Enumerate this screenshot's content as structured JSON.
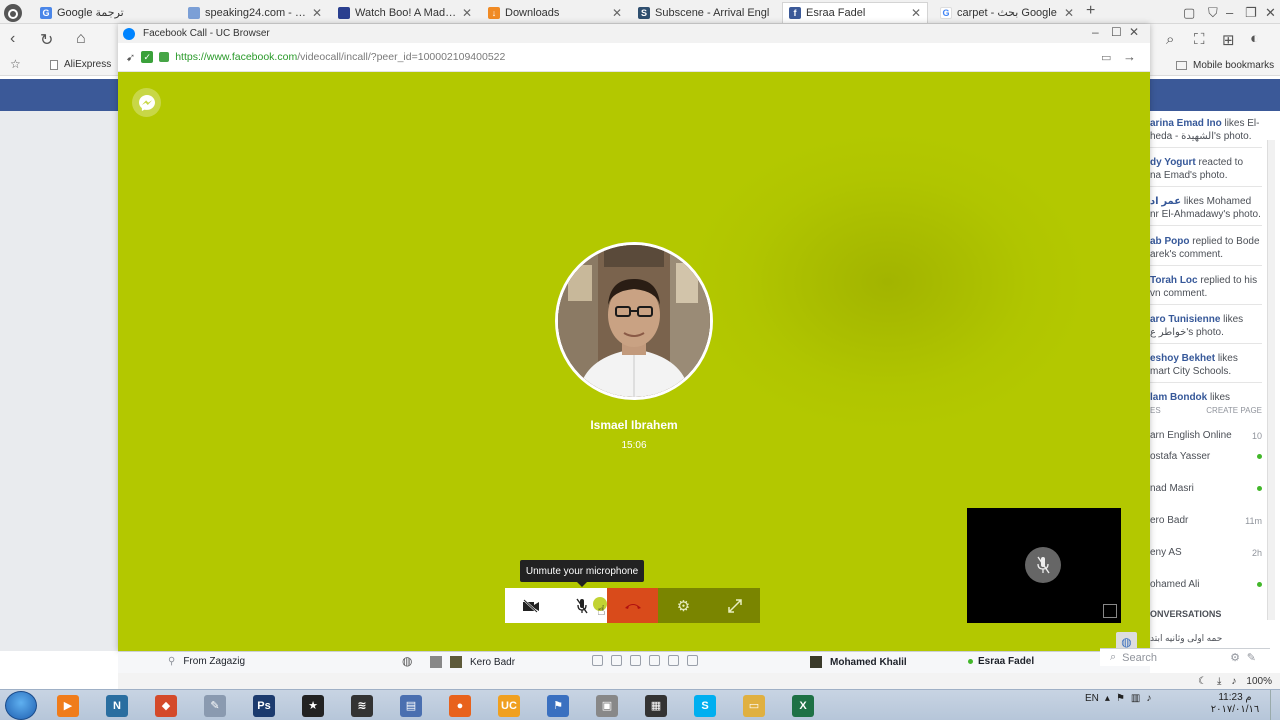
{
  "browser": {
    "tabs": [
      {
        "title": "Google ترجمة",
        "icon": "google-translate-icon",
        "color": "#4a86e8"
      },
      {
        "title": "speaking24.com - find a",
        "icon": "people-icon",
        "color": "#7b9fd6"
      },
      {
        "title": "Watch Boo! A Madea H",
        "icon": "film-icon",
        "color": "#2a3f8f"
      },
      {
        "title": "Downloads",
        "icon": "download-icon",
        "color": "#f08a24"
      },
      {
        "title": "Subscene - Arrival Engl",
        "icon": "subscene-icon",
        "color": "#2f4f6f"
      },
      {
        "title": "Esraa Fadel",
        "icon": "facebook-icon",
        "color": "#3b5998"
      },
      {
        "title": "carpet - بحث Google",
        "icon": "google-icon",
        "color": "#ffffff"
      }
    ],
    "bookmark_aliexpress": "AliExpress",
    "mobile_bookmarks": "Mobile bookmarks"
  },
  "popup": {
    "title": "Facebook Call - UC Browser",
    "url_host": "https://www.facebook.com",
    "url_path": "/videocall/incall/?peer_id=100002109400522"
  },
  "call": {
    "caller_name": "Ismael Ibrahem",
    "duration": "15:06",
    "tooltip": "Unmute your microphone",
    "bg_color": "#b3c800",
    "end_color": "#d94b1b"
  },
  "ticker": [
    {
      "name": "arina Emad Ino",
      "text": "likes El-",
      "line2": "heda - الشهيدة's photo."
    },
    {
      "name": "dy Yogurt",
      "text": "reacted to",
      "line2": "na Emad's photo."
    },
    {
      "name": "عمر اد",
      "text": "likes Mohamed",
      "line2": "nr El-Ahmadawy's photo."
    },
    {
      "name": "ab Popo",
      "text": "replied to Bode",
      "line2": "arek's comment."
    },
    {
      "name": "Torah Loc",
      "text": "replied to his",
      "line2": "vn comment."
    },
    {
      "name": "aro Tunisienne",
      "text": "likes",
      "line2": "خواطر ع's photo."
    },
    {
      "name": "eshoy Bekhet",
      "text": "likes",
      "line2": "mart City Schools."
    },
    {
      "name": "lam Bondok",
      "text": "likes",
      "line2": ""
    }
  ],
  "sidebar": {
    "pages_label": "ES",
    "create_page": "CREATE PAGE",
    "first_contact": "arn English Online",
    "first_count": "10",
    "contacts": [
      {
        "name": "ostafa Yasser",
        "status": "online"
      },
      {
        "name": "nad Masri",
        "status": "online"
      },
      {
        "name": "ero Badr",
        "time": "11m"
      },
      {
        "name": "eny AS",
        "time": "2h"
      },
      {
        "name": "ohamed Ali",
        "status": "online"
      }
    ],
    "conversations_label": "ONVERSATIONS",
    "conversation_item": "حمه اولى وثانيه ابتد",
    "search_placeholder": "Search"
  },
  "chat_tabs": {
    "from": "From Zagazig",
    "tab1": "Kero Badr",
    "tab2": "Mohamed Khalil",
    "tab3": "Esraa Fadel"
  },
  "status_zoom": "100%",
  "taskbar": {
    "apps": [
      {
        "name": "media-player-icon",
        "label": "▶",
        "color": "#f07c1a"
      },
      {
        "name": "n-app-icon",
        "label": "N",
        "color": "#2a6ea0"
      },
      {
        "name": "game-icon",
        "label": "◆",
        "color": "#d44a2a"
      },
      {
        "name": "paint-icon",
        "label": "✎",
        "color": "#8a9ab0"
      },
      {
        "name": "photoshop-icon",
        "label": "Ps",
        "color": "#1c3b6e"
      },
      {
        "name": "movie-maker-icon",
        "label": "★",
        "color": "#222222"
      },
      {
        "name": "audio-editor-icon",
        "label": "≋",
        "color": "#333333"
      },
      {
        "name": "save-app-icon",
        "label": "▤",
        "color": "#4a6fb0"
      },
      {
        "name": "firefox-icon",
        "label": "●",
        "color": "#e8621c"
      },
      {
        "name": "uc-browser-icon",
        "label": "UC",
        "color": "#f0a020"
      },
      {
        "name": "network-app-icon",
        "label": "⚑",
        "color": "#3a70c0"
      },
      {
        "name": "cube-app-icon",
        "label": "▣",
        "color": "#888888"
      },
      {
        "name": "video-app-icon",
        "label": "▦",
        "color": "#333333"
      },
      {
        "name": "skype-icon",
        "label": "S",
        "color": "#00aff0"
      },
      {
        "name": "explorer-icon",
        "label": "▭",
        "color": "#e0b040"
      },
      {
        "name": "excel-icon",
        "label": "X",
        "color": "#1e7145"
      }
    ],
    "lang": "EN",
    "time": "11:23 م",
    "date": "٢٠١٧/٠١/١٦"
  }
}
